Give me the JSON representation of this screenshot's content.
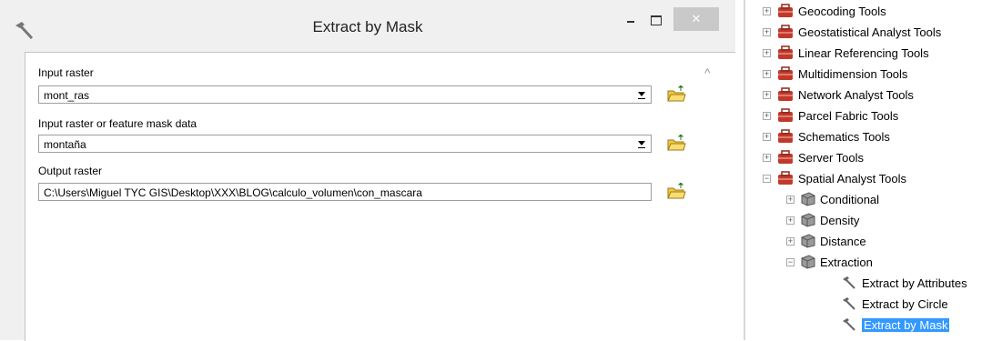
{
  "dialog": {
    "title": "Extract by Mask",
    "window_controls": {
      "minimize": "−",
      "maximize": "□",
      "close": "✕"
    },
    "fields": [
      {
        "label": "Input raster",
        "value": "mont_ras",
        "type": "combo"
      },
      {
        "label": "Input raster or feature mask data",
        "value": "montaña",
        "type": "combo"
      },
      {
        "label": "Output raster",
        "value": "C:\\Users\\Miguel TYC GIS\\Desktop\\XXX\\BLOG\\calculo_volumen\\con_mascara",
        "type": "text"
      }
    ],
    "scroll_up_glyph": "^"
  },
  "tree": {
    "items": [
      {
        "label": "Geocoding Tools",
        "expander": "+",
        "icon": "toolbox-icon",
        "selected": false
      },
      {
        "label": "Geostatistical Analyst Tools",
        "expander": "+",
        "icon": "toolbox-icon",
        "selected": false
      },
      {
        "label": "Linear Referencing Tools",
        "expander": "+",
        "icon": "toolbox-icon",
        "selected": false
      },
      {
        "label": "Multidimension Tools",
        "expander": "+",
        "icon": "toolbox-icon",
        "selected": false
      },
      {
        "label": "Network Analyst Tools",
        "expander": "+",
        "icon": "toolbox-icon",
        "selected": false
      },
      {
        "label": "Parcel Fabric Tools",
        "expander": "+",
        "icon": "toolbox-icon",
        "selected": false
      },
      {
        "label": "Schematics Tools",
        "expander": "+",
        "icon": "toolbox-icon",
        "selected": false
      },
      {
        "label": "Server Tools",
        "expander": "+",
        "icon": "toolbox-icon",
        "selected": false
      },
      {
        "label": "Spatial Analyst Tools",
        "expander": "−",
        "icon": "toolbox-icon",
        "selected": false
      },
      {
        "label": "Conditional",
        "expander": "+",
        "icon": "toolset-icon",
        "selected": false
      },
      {
        "label": "Density",
        "expander": "+",
        "icon": "toolset-icon",
        "selected": false
      },
      {
        "label": "Distance",
        "expander": "+",
        "icon": "toolset-icon",
        "selected": false
      },
      {
        "label": "Extraction",
        "expander": "−",
        "icon": "toolset-icon",
        "selected": false
      },
      {
        "label": "Extract by Attributes",
        "expander": "",
        "icon": "tool-hammer-icon",
        "selected": false
      },
      {
        "label": "Extract by Circle",
        "expander": "",
        "icon": "tool-hammer-icon",
        "selected": false
      },
      {
        "label": "Extract by Mask",
        "expander": "",
        "icon": "tool-hammer-icon",
        "selected": true
      }
    ]
  }
}
